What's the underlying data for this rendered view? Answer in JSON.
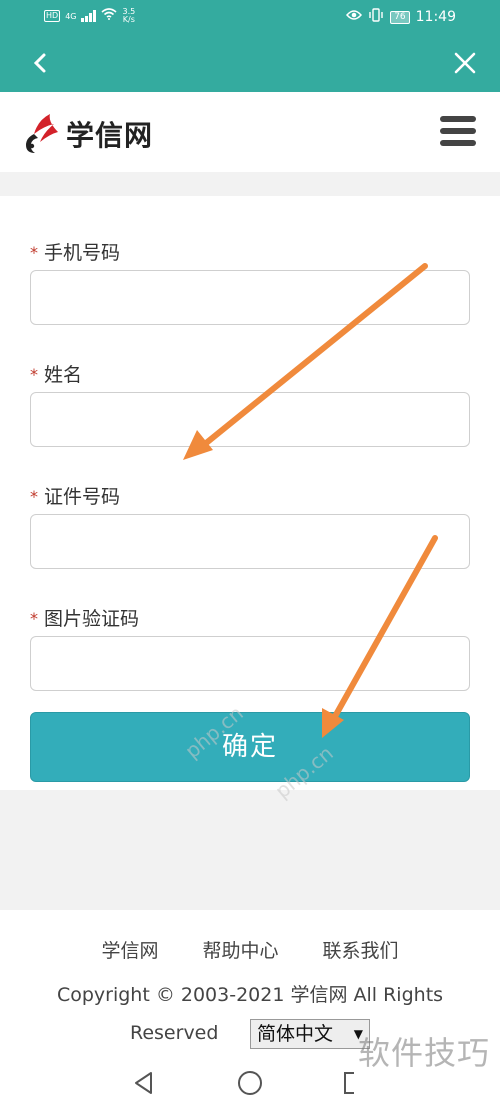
{
  "status_bar": {
    "hd": "HD",
    "signal": "4G",
    "speed_top": "3.5",
    "speed_bottom": "K/s",
    "battery": "76",
    "time": "11:49"
  },
  "title_bar": {
    "back_icon": "chevron-left-icon",
    "close_icon": "close-icon"
  },
  "header": {
    "logo_text": "学信网",
    "menu_icon": "hamburger-menu-icon"
  },
  "form": {
    "required_mark": "*",
    "fields": [
      {
        "label": "手机号码",
        "value": ""
      },
      {
        "label": "姓名",
        "value": ""
      },
      {
        "label": "证件号码",
        "value": ""
      },
      {
        "label": "图片验证码",
        "value": ""
      }
    ],
    "submit_label": "确定"
  },
  "footer": {
    "links": [
      "学信网",
      "帮助中心",
      "联系我们"
    ],
    "copyright": "Copyright © 2003-2021 学信网 All Rights",
    "reserved": "Reserved",
    "language_selected": "简体中文"
  },
  "watermark": {
    "corner_text": "软件技巧",
    "diag_text": "php.cn"
  },
  "colors": {
    "teal": "#34ab9f",
    "button": "#33adba",
    "arrow": "#f08a3c"
  }
}
